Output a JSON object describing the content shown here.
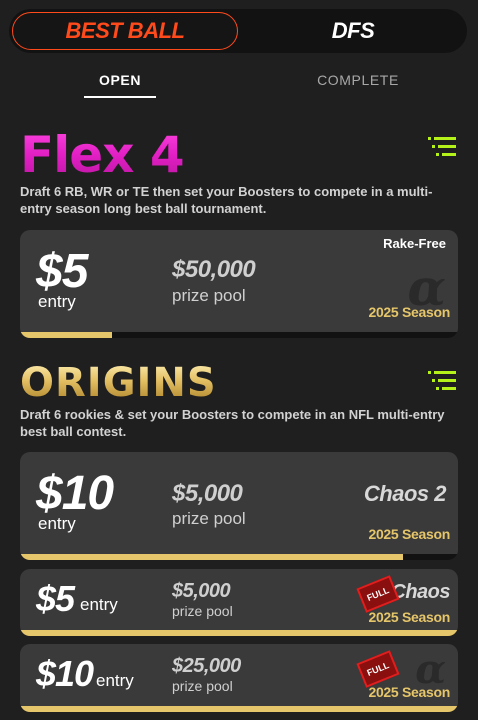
{
  "header": {
    "segments": [
      {
        "label": "BEST BALL",
        "active": true
      },
      {
        "label": "DFS",
        "active": false
      }
    ]
  },
  "tabs": [
    {
      "label": "OPEN",
      "active": true
    },
    {
      "label": "COMPLETE",
      "active": false
    }
  ],
  "colors": {
    "accent": "#ff4a1c",
    "gold": "#e6c66a",
    "magenta": "#e21fc4",
    "lime": "#b5f219",
    "full_red": "#e01e1e"
  },
  "sections": [
    {
      "logo_text": "Flex 4",
      "description": "Draft 6 RB, WR or TE then set your Boosters to compete in a multi-entry season long best ball tournament.",
      "menu_icon": "list-icon",
      "contests": [
        {
          "entry": "$5",
          "entry_label": "entry",
          "prize": "$50,000",
          "prize_label": "prize pool",
          "tag": "Rake-Free",
          "season": "2025 Season",
          "icon": "alpha-icon",
          "fill": 0.21
        }
      ]
    },
    {
      "logo_text": "ORIGINS",
      "description": "Draft 6 rookies & set your Boosters to compete in an NFL multi-entry best ball contest.",
      "menu_icon": "list-icon",
      "contests": [
        {
          "entry": "$10",
          "entry_label": "entry",
          "prize": "$5,000",
          "prize_label": "prize pool",
          "tag": "Chaos 2",
          "season": "2025 Season",
          "fill": 0.875
        },
        {
          "entry": "$5",
          "entry_label": "entry",
          "prize": "$5,000",
          "prize_label": "prize pool",
          "tag": "Chaos",
          "badge": "FULL",
          "season": "2025 Season",
          "fill": 1.0
        },
        {
          "entry": "$10",
          "entry_label": "entry",
          "prize": "$25,000",
          "prize_label": "prize pool",
          "badge": "FULL",
          "season": "2025 Season",
          "icon": "alpha-icon",
          "fill": 1.0
        }
      ]
    }
  ]
}
